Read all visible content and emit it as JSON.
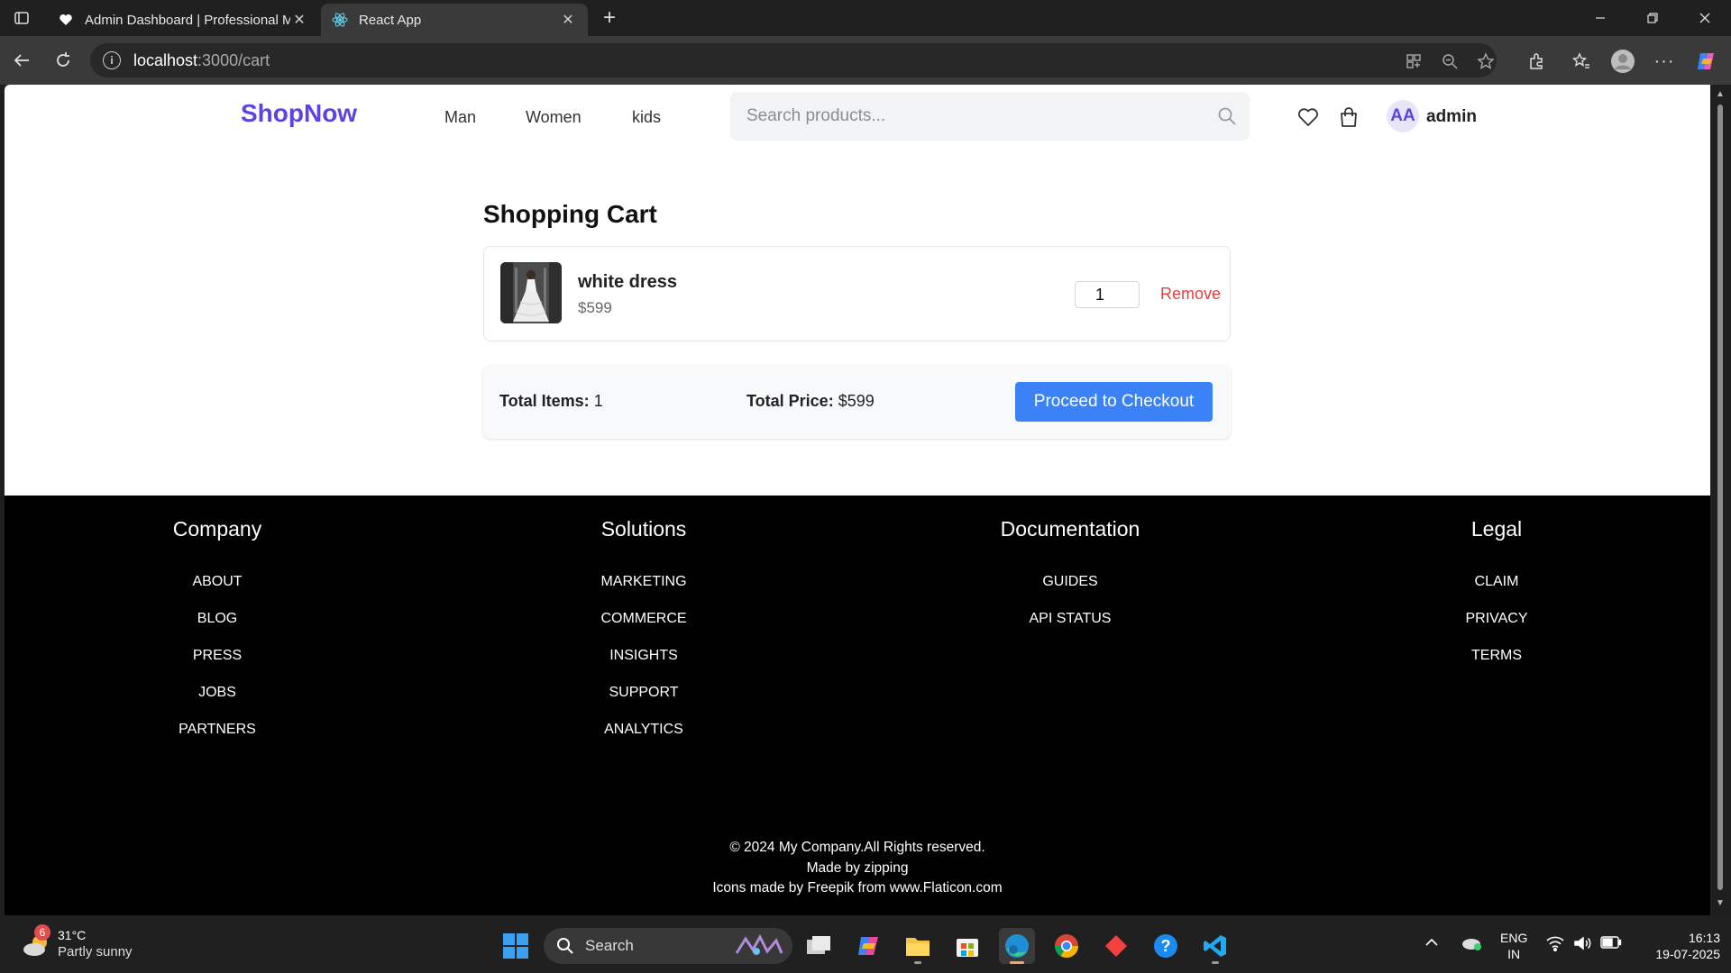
{
  "browser": {
    "tabs": [
      {
        "title": "Admin Dashboard | Professional M",
        "icon": "heart-icon",
        "active": false
      },
      {
        "title": "React App",
        "icon": "react-icon",
        "active": true
      }
    ],
    "url_host": "localhost",
    "url_path": ":3000/cart"
  },
  "header": {
    "logo": "ShopNow",
    "nav": [
      "Man",
      "Women",
      "kids"
    ],
    "search_placeholder": "Search products...",
    "avatar_initials": "AA",
    "username": "admin"
  },
  "cart": {
    "title": "Shopping Cart",
    "items": [
      {
        "name": "white dress",
        "price": "$599",
        "quantity": "1",
        "remove_label": "Remove"
      }
    ],
    "summary": {
      "total_items_label": "Total Items:",
      "total_items_value": "1",
      "total_price_label": "Total Price:",
      "total_price_value": "$599",
      "checkout_label": "Proceed to Checkout"
    }
  },
  "footer": {
    "columns": [
      {
        "heading": "Company",
        "links": [
          "ABOUT",
          "BLOG",
          "PRESS",
          "JOBS",
          "PARTNERS"
        ]
      },
      {
        "heading": "Solutions",
        "links": [
          "MARKETING",
          "COMMERCE",
          "INSIGHTS",
          "SUPPORT",
          "ANALYTICS"
        ]
      },
      {
        "heading": "Documentation",
        "links": [
          "GUIDES",
          "API STATUS"
        ]
      },
      {
        "heading": "Legal",
        "links": [
          "CLAIM",
          "PRIVACY",
          "TERMS"
        ]
      }
    ],
    "copyright": "© 2024 My Company.All Rights reserved.",
    "made_by": "Made by zipping",
    "icons_credit": "Icons made by Freepik from www.Flaticon.com"
  },
  "taskbar": {
    "weather_temp": "31°C",
    "weather_cond": "Partly sunny",
    "weather_badge": "6",
    "search_label": "Search",
    "lang_top": "ENG",
    "lang_bottom": "IN",
    "time": "16:13",
    "date": "19-07-2025"
  },
  "colors": {
    "brand": "#5b45e0",
    "checkout_button": "#3b82f6",
    "remove_link": "#e53e3e",
    "footer_bg": "#000000"
  }
}
